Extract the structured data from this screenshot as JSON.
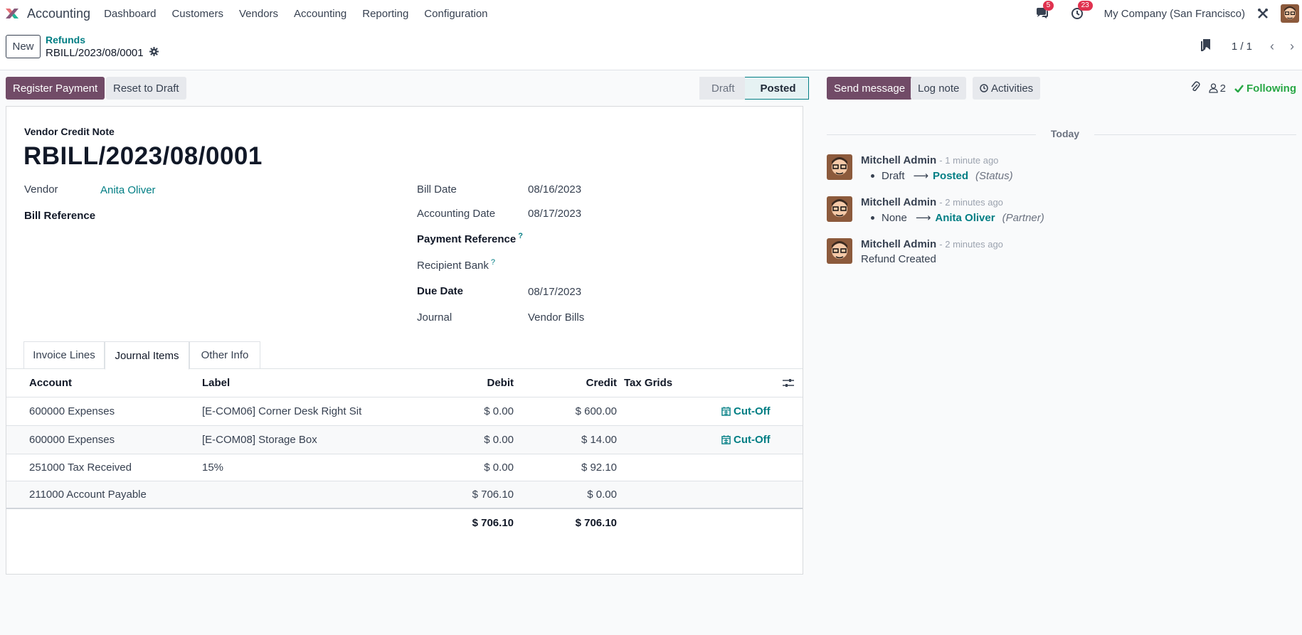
{
  "navbar": {
    "app_name": "Accounting",
    "menu": [
      "Dashboard",
      "Customers",
      "Vendors",
      "Accounting",
      "Reporting",
      "Configuration"
    ],
    "messages_badge": "5",
    "activities_badge": "23",
    "company": "My Company (San Francisco)"
  },
  "control": {
    "new_label": "New",
    "breadcrumb": "Refunds",
    "record_name": "RBILL/2023/08/0001",
    "pager_value": "1 / 1"
  },
  "actions": {
    "register_payment": "Register Payment",
    "reset_to_draft": "Reset to Draft"
  },
  "status": {
    "steps": [
      "Draft",
      "Posted"
    ],
    "current": "Posted"
  },
  "form": {
    "doc_type": "Vendor Credit Note",
    "title": "RBILL/2023/08/0001",
    "vendor_label": "Vendor",
    "vendor_value": "Anita Oliver",
    "bill_reference_label": "Bill Reference",
    "bill_date_label": "Bill Date",
    "bill_date_value": "08/16/2023",
    "accounting_date_label": "Accounting Date",
    "accounting_date_value": "08/17/2023",
    "payment_reference_label": "Payment Reference",
    "recipient_bank_label": "Recipient Bank",
    "due_date_label": "Due Date",
    "due_date_value": "08/17/2023",
    "journal_label": "Journal",
    "journal_value": "Vendor Bills",
    "help_mark": "?"
  },
  "tabs": [
    "Invoice Lines",
    "Journal Items",
    "Other Info"
  ],
  "journal_items": {
    "columns": {
      "account": "Account",
      "label": "Label",
      "debit": "Debit",
      "credit": "Credit",
      "tax_grids": "Tax Grids"
    },
    "rows": [
      {
        "account": "600000 Expenses",
        "label": "[E-COM06] Corner Desk Right Sit",
        "debit": "$ 0.00",
        "credit": "$ 600.00",
        "action": "Cut-Off"
      },
      {
        "account": "600000 Expenses",
        "label": "[E-COM08] Storage Box",
        "debit": "$ 0.00",
        "credit": "$ 14.00",
        "action": "Cut-Off"
      },
      {
        "account": "251000 Tax Received",
        "label": "15%",
        "debit": "$ 0.00",
        "credit": "$ 92.10",
        "action": ""
      },
      {
        "account": "211000 Account Payable",
        "label": "",
        "debit": "$ 706.10",
        "credit": "$ 0.00",
        "action": ""
      }
    ],
    "total_debit": "$ 706.10",
    "total_credit": "$ 706.10"
  },
  "chatter": {
    "send_message": "Send message",
    "log_note": "Log note",
    "activities": "Activities",
    "followers_count": "2",
    "following": "Following",
    "separator": "Today",
    "messages": [
      {
        "author": "Mitchell Admin",
        "date": "- 1 minute ago",
        "old": "Draft",
        "new": "Posted",
        "field": "(Status)"
      },
      {
        "author": "Mitchell Admin",
        "date": "- 2 minutes ago",
        "old": "None",
        "new": "Anita Oliver",
        "field": "(Partner)"
      },
      {
        "author": "Mitchell Admin",
        "date": "- 2 minutes ago",
        "text": "Refund Created"
      }
    ]
  },
  "colors": {
    "primary": "#714b67",
    "link": "#017e84",
    "following": "#28a745",
    "badge": "#e0324f"
  }
}
